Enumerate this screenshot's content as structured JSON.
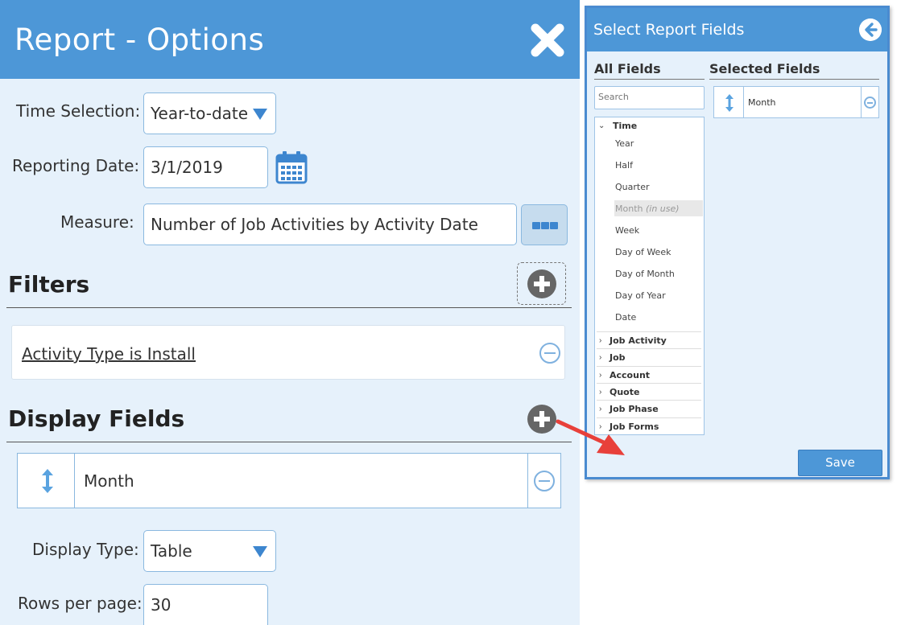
{
  "report_options": {
    "title": "Report - Options",
    "close_icon": "close-x-icon",
    "time_selection": {
      "label": "Time Selection:",
      "value": "Year-to-date"
    },
    "reporting_date": {
      "label": "Reporting Date:",
      "value": "3/1/2019",
      "icon": "calendar-icon"
    },
    "measure": {
      "label": "Measure:",
      "value": "Number of Job Activities by Activity Date",
      "button_icon": "ellipsis-icon"
    },
    "filters": {
      "title": "Filters",
      "items": [
        "Activity Type is Install"
      ]
    },
    "display_fields": {
      "title": "Display Fields",
      "items": [
        "Month"
      ]
    },
    "display_type": {
      "label": "Display Type:",
      "value": "Table"
    },
    "rows_per_page": {
      "label": "Rows per page:",
      "value": "30"
    }
  },
  "select_fields": {
    "title": "Select Report Fields",
    "back_icon": "back-arrow-icon",
    "all_fields_header": "All Fields",
    "selected_fields_header": "Selected Fields",
    "search_placeholder": "Search",
    "time_group": "Time",
    "time_items": [
      "Year",
      "Half",
      "Quarter",
      "Month",
      "Week",
      "Day of Week",
      "Day of Month",
      "Day of Year",
      "Date"
    ],
    "in_use_suffix": "(in use)",
    "groups": [
      "Job Activity",
      "Job",
      "Account",
      "Quote",
      "Job Phase",
      "Job Forms"
    ],
    "selected": [
      "Month"
    ],
    "save_label": "Save"
  },
  "colors": {
    "header_blue": "#4d97d7",
    "panel_bg": "#e6f1fb",
    "accent": "#3d86cf",
    "annotation_arrow": "#e8403a"
  }
}
